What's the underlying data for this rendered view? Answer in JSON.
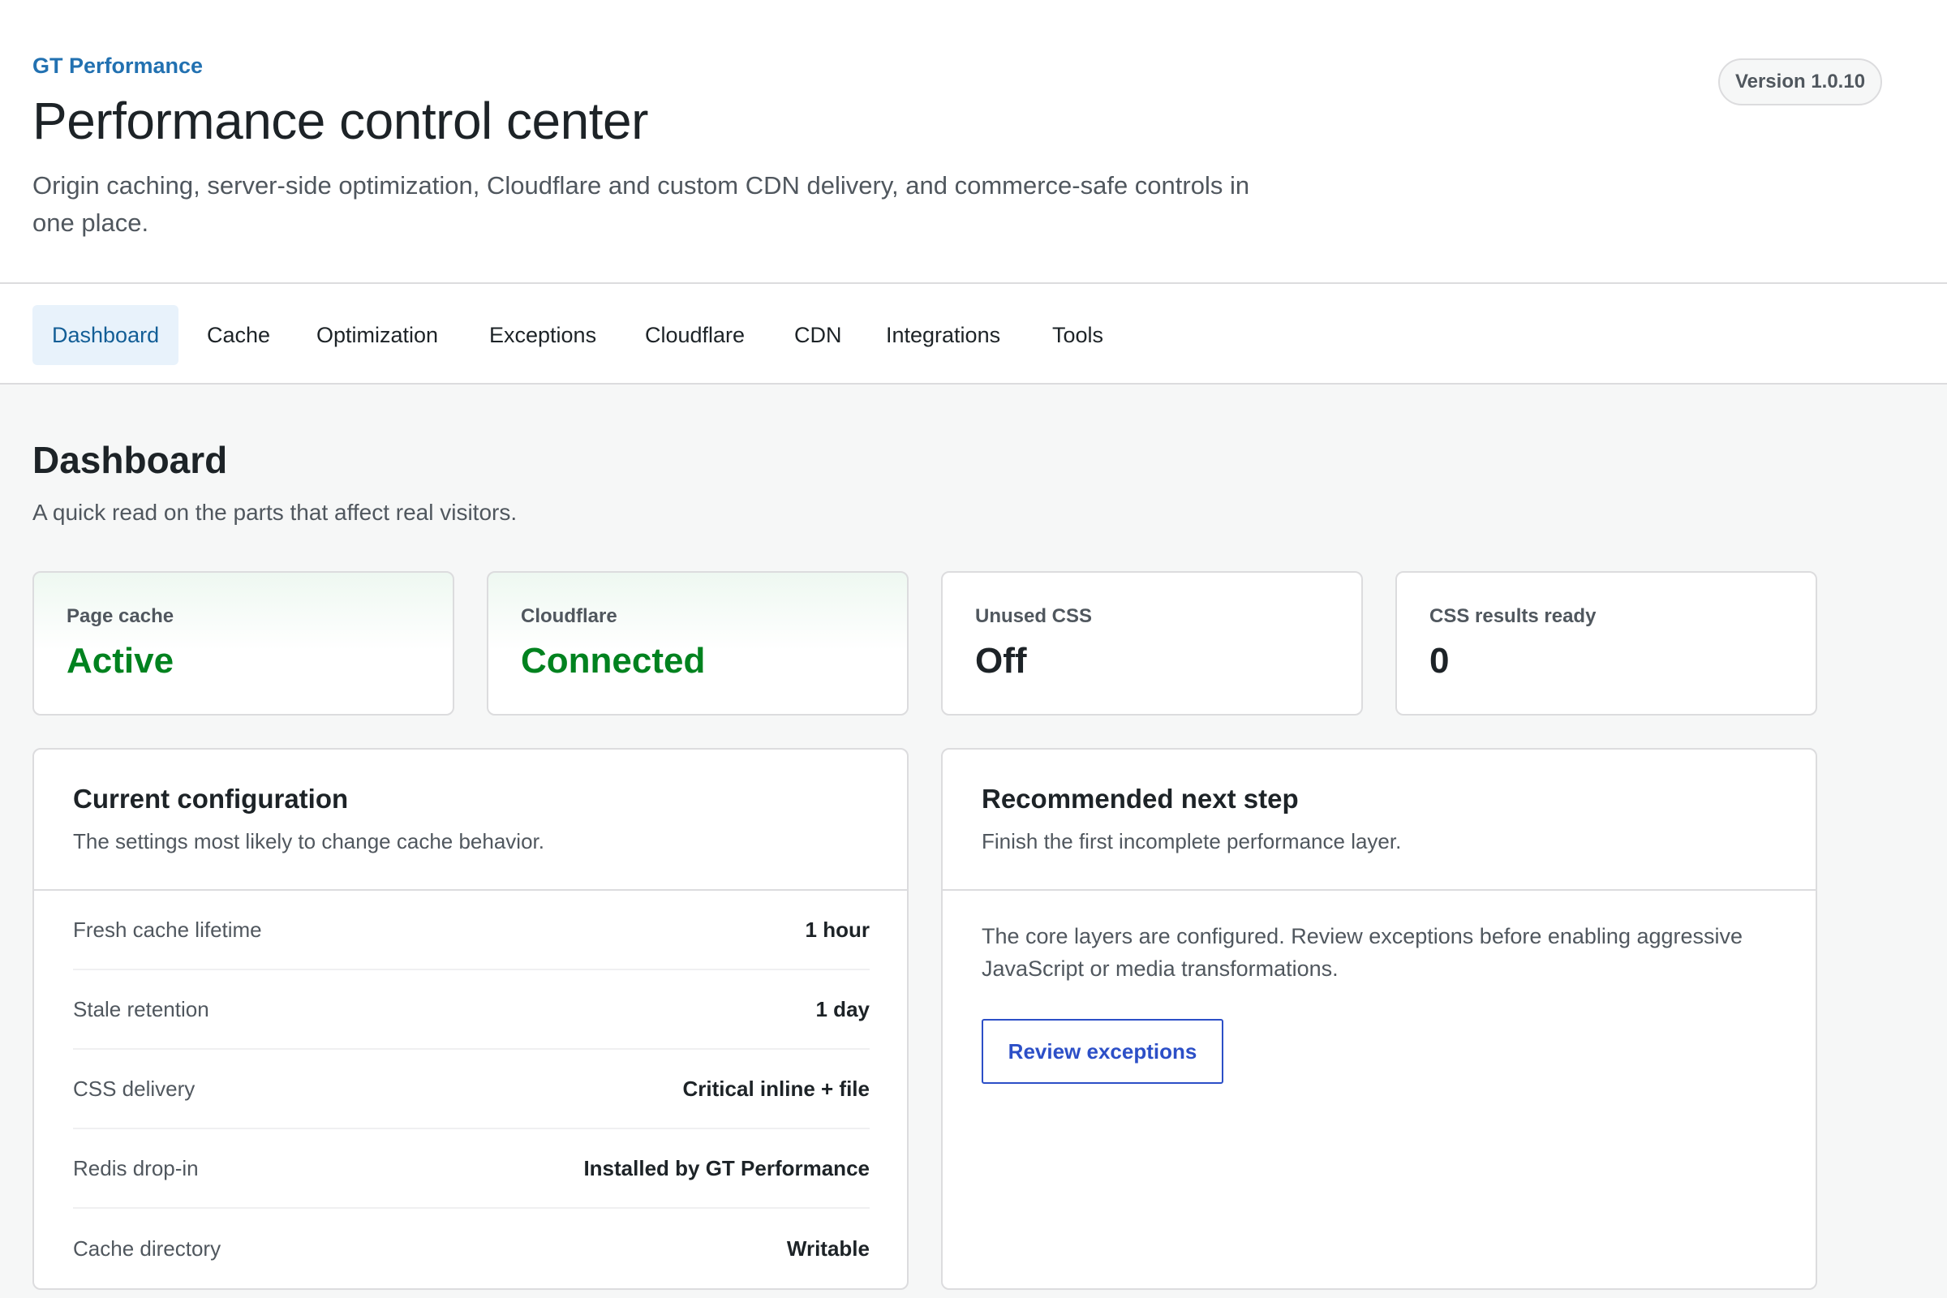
{
  "header": {
    "brand": "GT Performance",
    "title": "Performance control center",
    "subtitle": "Origin caching, server-side optimization, Cloudflare and custom CDN delivery, and commerce-safe controls in one place.",
    "version_badge": "Version 1.0.10"
  },
  "tabs": [
    {
      "label": "Dashboard",
      "active": true
    },
    {
      "label": "Cache",
      "active": false
    },
    {
      "label": "Optimization",
      "active": false
    },
    {
      "label": "Exceptions",
      "active": false
    },
    {
      "label": "Cloudflare",
      "active": false
    },
    {
      "label": "CDN",
      "active": false
    },
    {
      "label": "Integrations",
      "active": false
    },
    {
      "label": "Tools",
      "active": false
    }
  ],
  "main": {
    "title": "Dashboard",
    "description": "A quick read on the parts that affect real visitors."
  },
  "stats": [
    {
      "label": "Page cache",
      "value": "Active",
      "status": "good"
    },
    {
      "label": "Cloudflare",
      "value": "Connected",
      "status": "good"
    },
    {
      "label": "Unused CSS",
      "value": "Off",
      "status": "neutral"
    },
    {
      "label": "CSS results ready",
      "value": "0",
      "status": "neutral"
    }
  ],
  "config": {
    "title": "Current configuration",
    "description": "The settings most likely to change cache behavior.",
    "rows": [
      {
        "key": "Fresh cache lifetime",
        "value": "1 hour"
      },
      {
        "key": "Stale retention",
        "value": "1 day"
      },
      {
        "key": "CSS delivery",
        "value": "Critical inline + file"
      },
      {
        "key": "Redis drop-in",
        "value": "Installed by GT Performance"
      },
      {
        "key": "Cache directory",
        "value": "Writable"
      }
    ]
  },
  "recommendation": {
    "title": "Recommended next step",
    "description": "Finish the first incomplete performance layer.",
    "body": "The core layers are configured. Review exceptions before enabling aggressive JavaScript or media transformations.",
    "button_label": "Review exceptions"
  },
  "colors": {
    "accent": "#2271b1",
    "good": "#00821f",
    "button": "#2c4fc7",
    "tab_active_bg": "#e8f2fb"
  }
}
